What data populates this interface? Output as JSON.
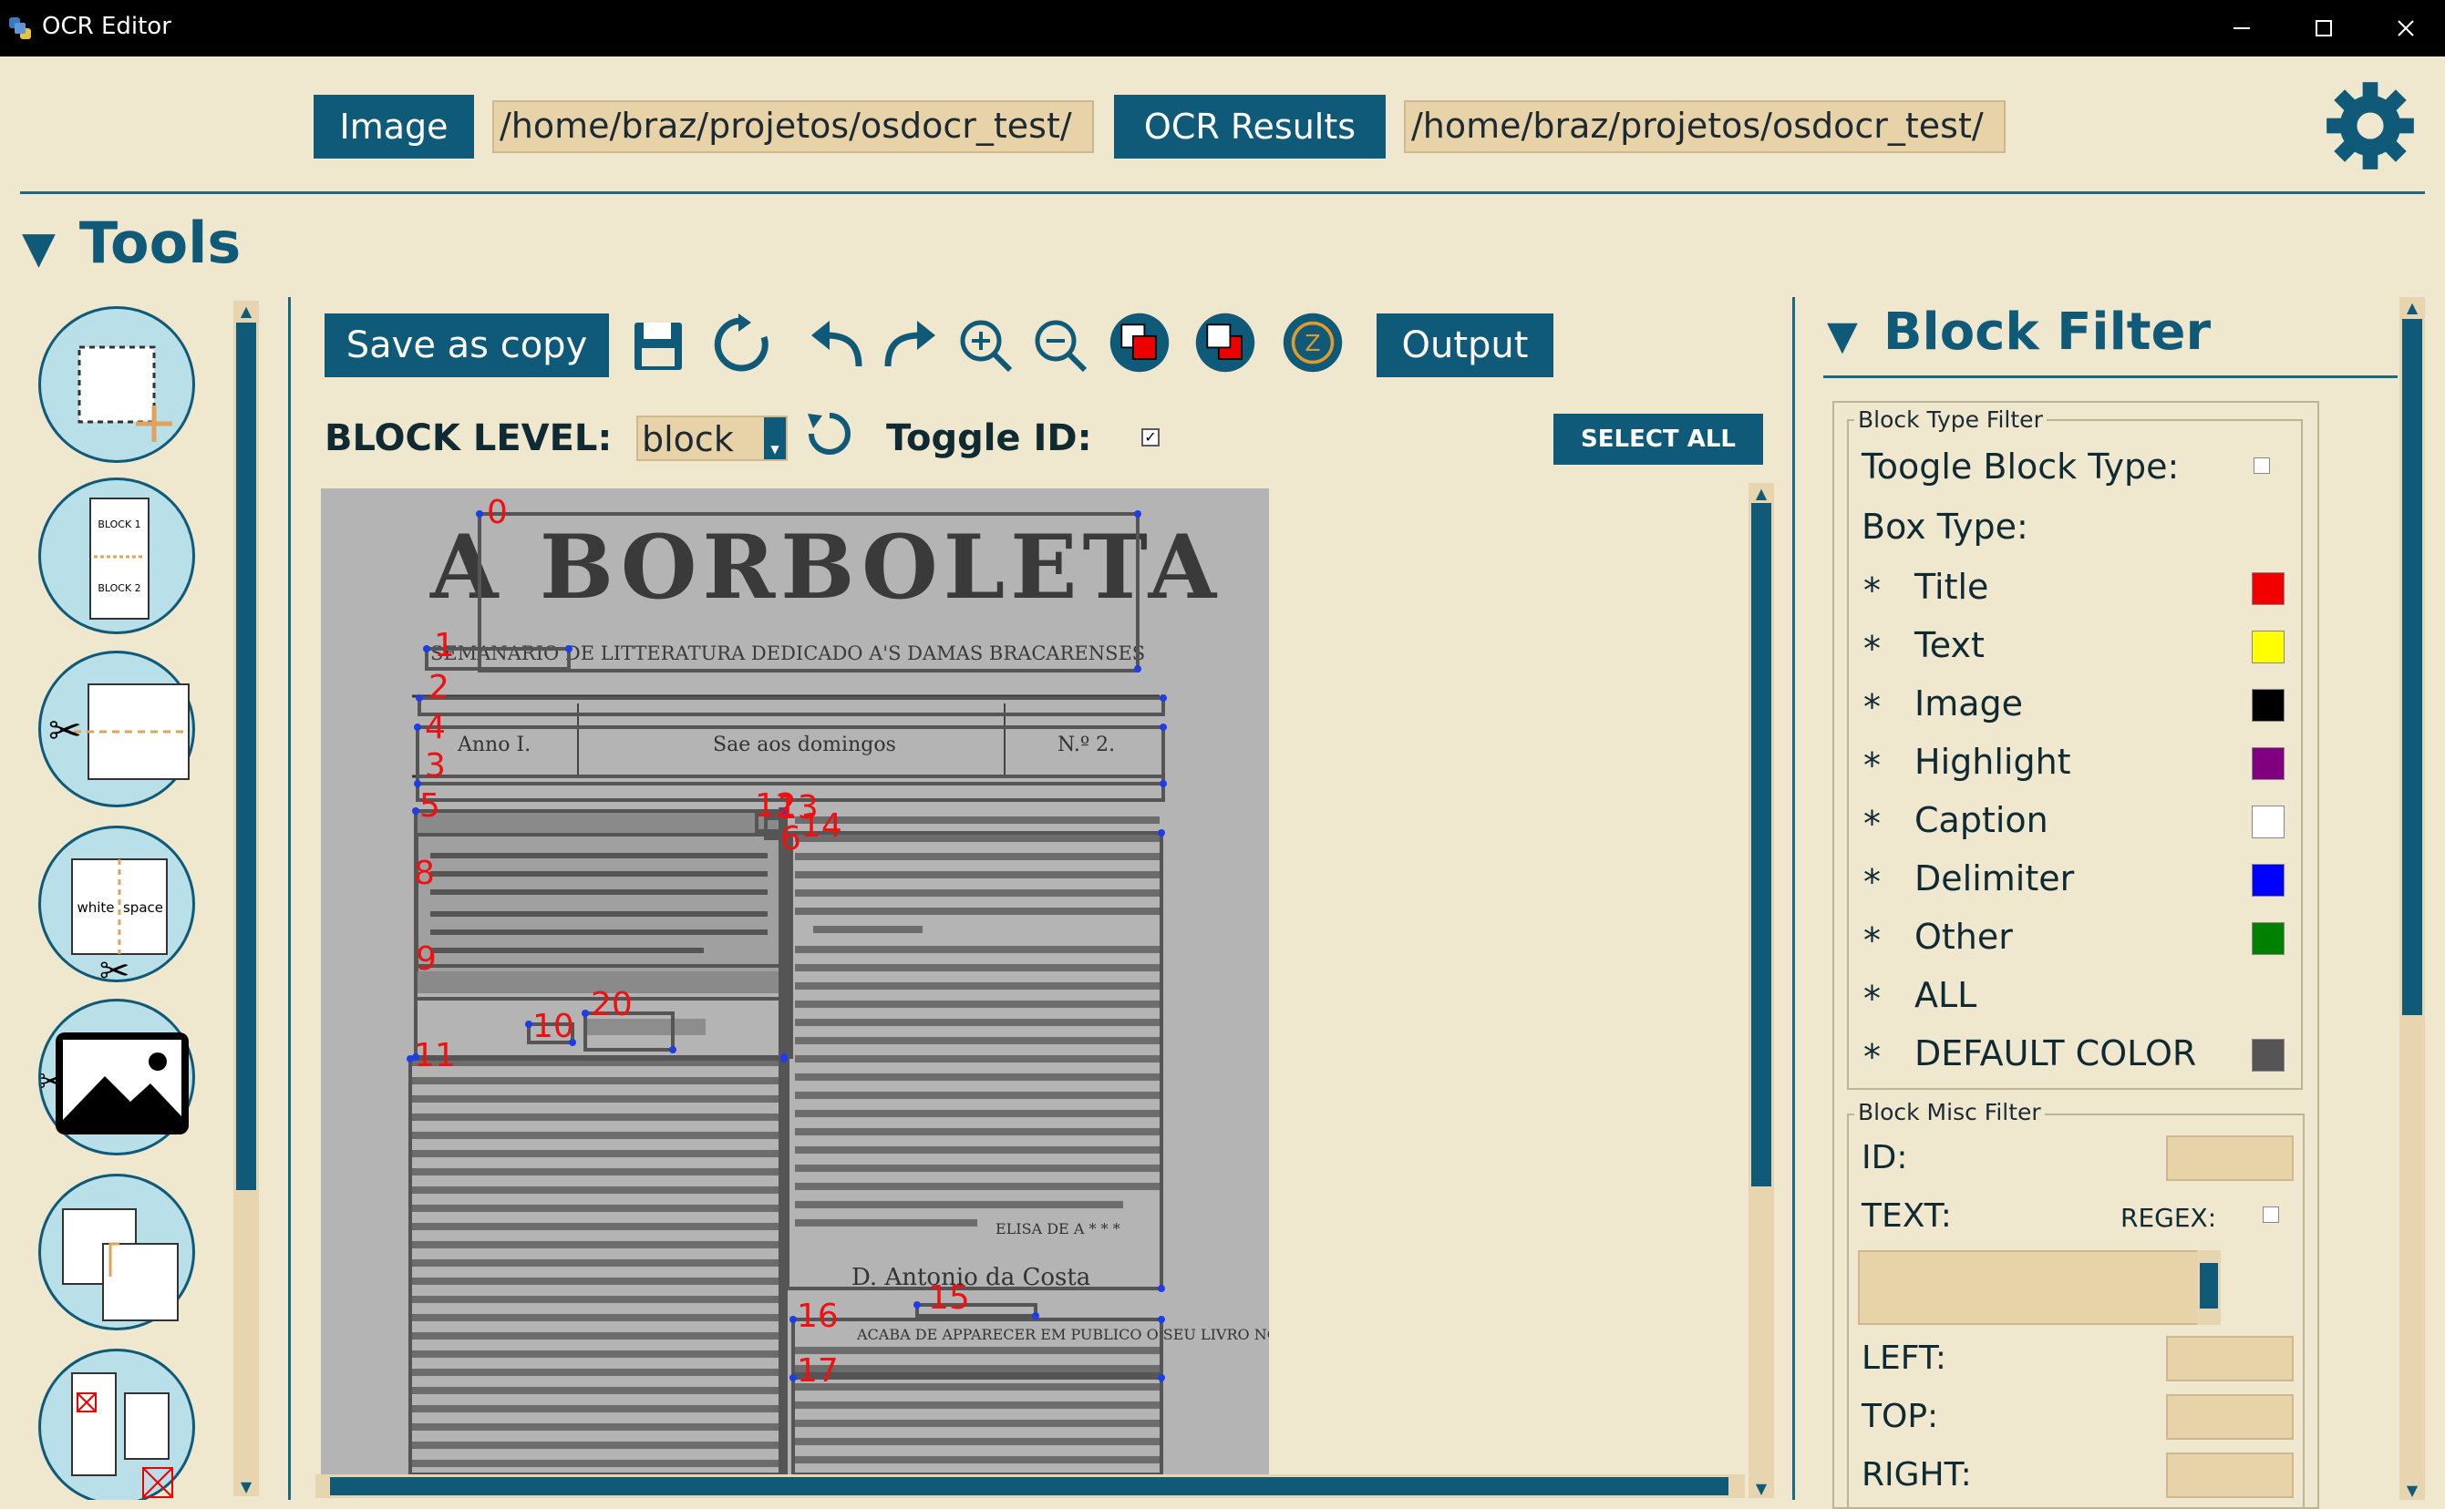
{
  "window": {
    "title": "OCR Editor",
    "controls": [
      "minimize",
      "maximize",
      "close"
    ]
  },
  "header": {
    "image_button": "Image",
    "image_path": "/home/braz/projetos/osdocr_test/",
    "ocr_button": "OCR Results",
    "ocr_path": "/home/braz/projetos/osdocr_test/",
    "settings_icon": "gear-icon"
  },
  "tools": {
    "title": "Tools",
    "items": [
      {
        "name": "add-block-tool",
        "label": ""
      },
      {
        "name": "join-blocks-tool",
        "label1": "BLOCK 1",
        "label2": "BLOCK 2"
      },
      {
        "name": "split-block-tool"
      },
      {
        "name": "split-whitespace-tool",
        "label1": "white",
        "label2": "space"
      },
      {
        "name": "cut-image-tool"
      },
      {
        "name": "copy-block-tool"
      },
      {
        "name": "delete-blocks-tool"
      }
    ]
  },
  "toolbar": {
    "save_copy": "Save as copy",
    "output": "Output",
    "block_level_label": "BLOCK LEVEL:",
    "block_level_value": "block",
    "toggle_id_label": "Toggle ID:",
    "toggle_id_checked": "✓",
    "select_all": "SELECT ALL"
  },
  "document": {
    "masthead": "A BORBOLETA",
    "subtitle": "SEMANARIO DE LITTERATURA DEDICADO A'S DAMAS BRACARENSES",
    "anno": "Anno I.",
    "sae": "Sae aos domingos",
    "numero": "N.º 2.",
    "heading16": "D. Antonio da Costa",
    "heading17": "ACABA DE APPARECER EM PUBLICO O SEU LIVRO NO MINHO",
    "signature": "ELISA DE A * * *",
    "block_ids": [
      "0",
      "1",
      "2",
      "4",
      "3",
      "5",
      "12",
      "13",
      "14",
      "6",
      "8",
      "9",
      "20",
      "10",
      "11",
      "15",
      "16",
      "17"
    ]
  },
  "block_filter": {
    "title": "Block Filter",
    "type_group": "Block Type Filter",
    "toggle_label": "Toogle Block Type:",
    "box_type_label": "Box Type:",
    "types": [
      {
        "label": "Title",
        "color": "#f20000"
      },
      {
        "label": "Text",
        "color": "#ffff00"
      },
      {
        "label": "Image",
        "color": "#000000"
      },
      {
        "label": "Highlight",
        "color": "#800080"
      },
      {
        "label": "Caption",
        "color": "#ffffff"
      },
      {
        "label": "Delimiter",
        "color": "#0000ff"
      },
      {
        "label": "Other",
        "color": "#008000"
      },
      {
        "label": "ALL",
        "color": ""
      },
      {
        "label": "DEFAULT COLOR",
        "color": "#555555"
      }
    ],
    "bullet": "*",
    "misc_group": "Block Misc Filter",
    "id_label": "ID:",
    "text_label": "TEXT:",
    "regex_label": "REGEX:",
    "left_label": "LEFT:",
    "top_label": "TOP:",
    "right_label": "RIGHT:"
  }
}
